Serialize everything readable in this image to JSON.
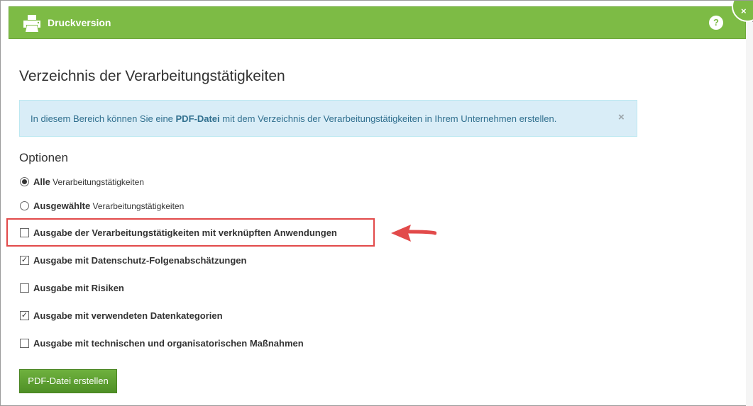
{
  "header": {
    "title": "Druckversion",
    "print_icon": "printer-icon",
    "help_label": "?",
    "close_label": "×",
    "background_color": "#7dbb45"
  },
  "page": {
    "title": "Verzeichnis der Verarbeitungstätigkeiten"
  },
  "info": {
    "text_before": "In diesem Bereich können Sie eine ",
    "text_bold": "PDF-Datei",
    "text_after": " mit dem Verzeichnis der Verarbeitungstätigkeiten in Ihrem Unternehmen erstellen.",
    "dismiss_label": "×",
    "background_color": "#d9edf7"
  },
  "options": {
    "title": "Optionen",
    "radios": [
      {
        "strong": "Alle",
        "rest": " Verarbeitungstätigkeiten",
        "checked": true
      },
      {
        "strong": "Ausgewählte",
        "rest": " Verarbeitungstätigkeiten",
        "checked": false
      }
    ],
    "checkboxes": [
      {
        "label": "Ausgabe der Verarbeitungstätigkeiten mit verknüpften Anwendungen",
        "checked": false,
        "highlighted": true
      },
      {
        "label": "Ausgabe mit Datenschutz-Folgenabschätzungen",
        "checked": true
      },
      {
        "label": "Ausgabe mit Risiken",
        "checked": false
      },
      {
        "label": "Ausgabe mit verwendeten Datenkategorien",
        "checked": true
      },
      {
        "label": "Ausgabe mit technischen und organisatorischen Maßnahmen",
        "checked": false
      }
    ]
  },
  "actions": {
    "create_pdf_label": "PDF-Datei erstellen",
    "button_color": "#5fa032"
  },
  "annotation": {
    "highlight_color": "#e24a4a",
    "arrow_icon": "arrow-left-icon"
  }
}
